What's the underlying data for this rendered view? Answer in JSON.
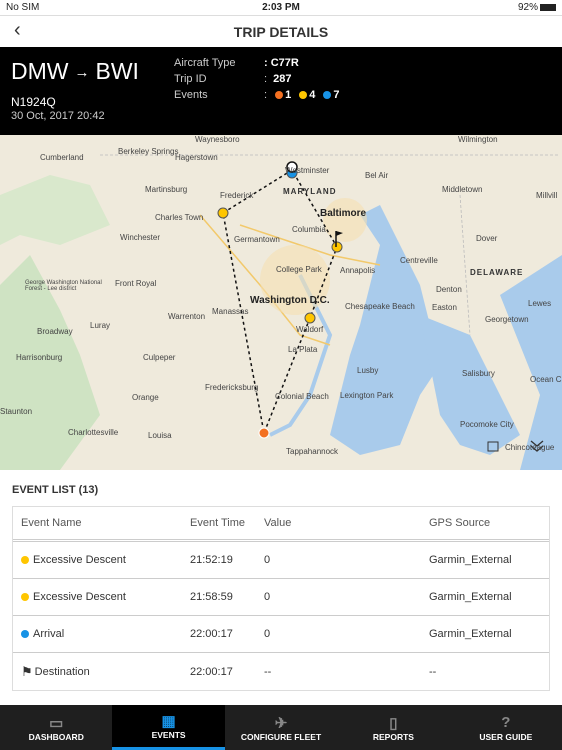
{
  "status": {
    "carrier": "No SIM",
    "time": "2:03 PM",
    "battery": "92%"
  },
  "nav": {
    "title": "TRIP DETAILS",
    "back_icon": "chevron-left"
  },
  "trip": {
    "origin": "DMW",
    "destination": "BWI",
    "tail": "N1924Q",
    "date": "30 Oct, 2017 20:42",
    "labels": {
      "aircraft_type": "Aircraft Type",
      "trip_id": "Trip ID",
      "events": "Events"
    },
    "aircraft_type": ": C77R",
    "trip_id": "287",
    "events_prefix": ":",
    "event_counts": [
      {
        "color": "#f37021",
        "count": "1"
      },
      {
        "color": "#ffc600",
        "count": "4"
      },
      {
        "color": "#1792e5",
        "count": "7"
      }
    ]
  },
  "map": {
    "labels": [
      "Waynesboro",
      "Berkeley Springs",
      "Hagerstown",
      "Westminster",
      "Wilmington",
      "Cumberland",
      "Martinsburg",
      "Frederick",
      "MARYLAND",
      "Bel Air",
      "Middletown",
      "Millvill",
      "Charles Town",
      "Baltimore",
      "Winchester",
      "Germantown",
      "Columbia",
      "Dover",
      "Front Royal",
      "College Park",
      "Annapolis",
      "Centreville",
      "DELAWARE",
      "George Washington National Forest - Lee district",
      "Washington D.C.",
      "Denton",
      "Warrenton",
      "Manassas",
      "Chesapeake Beach",
      "Easton",
      "Lewes",
      "Luray",
      "Waldorf",
      "Georgetown",
      "Broadway",
      "La Plata",
      "Harrisonburg",
      "Culpeper",
      "Lusby",
      "Salisbury",
      "Ocean C",
      "Fredericksburg",
      "Orange",
      "Colonial Beach",
      "Lexington Park",
      "Staunton",
      "Charlottesville",
      "Louisa",
      "Pocomoke City",
      "Tappahannock",
      "Chincoteague"
    ]
  },
  "event_list": {
    "title": "EVENT LIST (13)",
    "columns": [
      "Event Name",
      "Event Time",
      "Value",
      "GPS Source"
    ],
    "rows": [
      {
        "icon": "yellow-dot",
        "color": "#ffc600",
        "name": "Excessive Descent",
        "time": "21:52:19",
        "value": "0",
        "gps": "Garmin_External"
      },
      {
        "icon": "yellow-dot",
        "color": "#ffc600",
        "name": "Excessive Descent",
        "time": "21:58:59",
        "value": "0",
        "gps": "Garmin_External"
      },
      {
        "icon": "blue-dot",
        "color": "#1792e5",
        "name": "Arrival",
        "time": "22:00:17",
        "value": "0",
        "gps": "Garmin_External"
      },
      {
        "icon": "flag",
        "name": "Destination",
        "time": "22:00:17",
        "value": "--",
        "gps": "--"
      }
    ]
  },
  "tabs": [
    {
      "label": "DASHBOARD",
      "icon": "dashboard"
    },
    {
      "label": "EVENTS",
      "icon": "calendar",
      "active": true
    },
    {
      "label": "CONFIGURE FLEET",
      "icon": "aircraft"
    },
    {
      "label": "REPORTS",
      "icon": "document"
    },
    {
      "label": "USER GUIDE",
      "icon": "question"
    }
  ],
  "accent": "#1792e5"
}
